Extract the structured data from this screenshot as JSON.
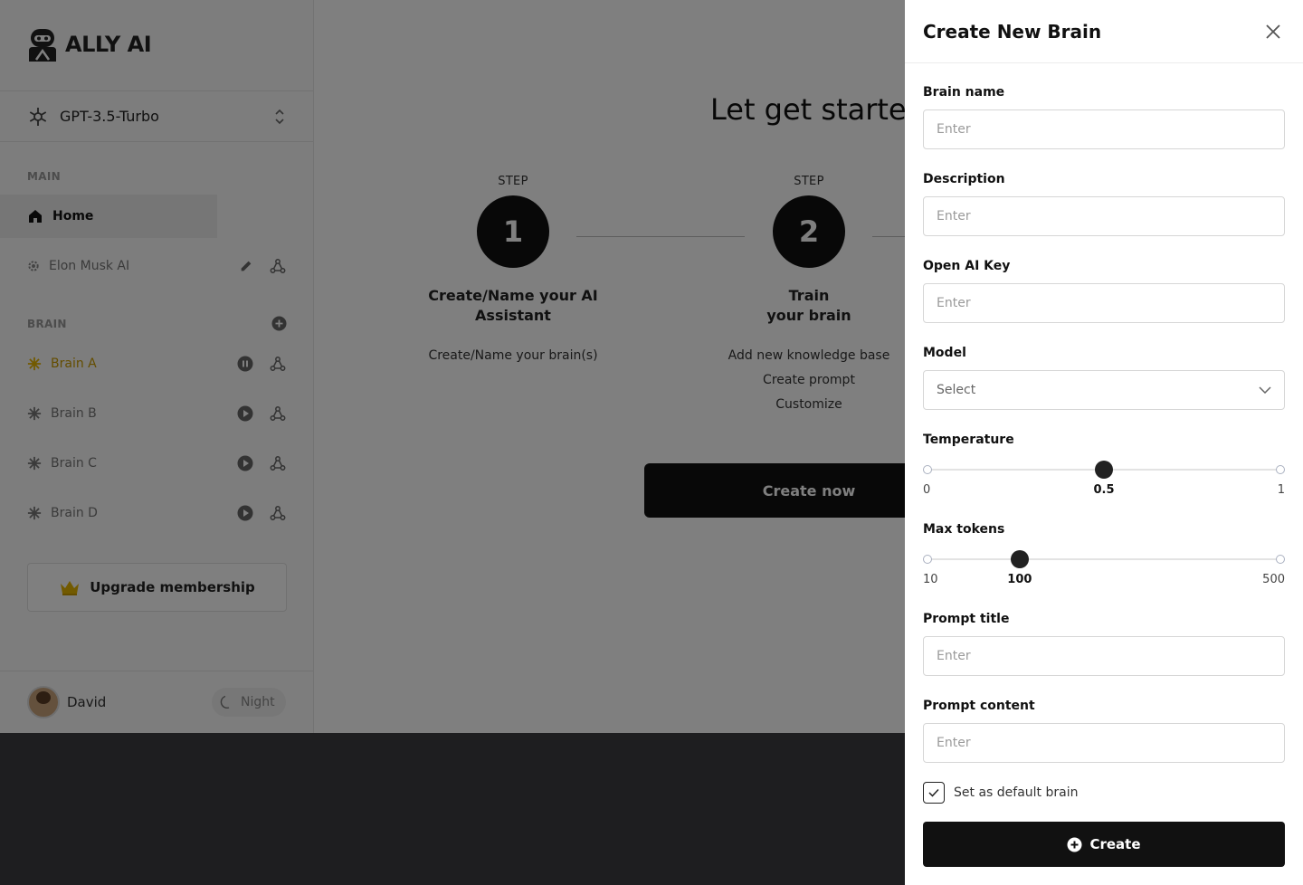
{
  "app": {
    "logo_text": "ALLY AI"
  },
  "sidebar": {
    "model": "GPT-3.5-Turbo",
    "main_section": "MAIN",
    "home_label": "Home",
    "assistant_label": "Elon Musk AI",
    "brain_section": "BRAIN",
    "brains": [
      {
        "label": "Brain A",
        "state": "pause"
      },
      {
        "label": "Brain B",
        "state": "play"
      },
      {
        "label": "Brain C",
        "state": "play"
      },
      {
        "label": "Brain D",
        "state": "play"
      }
    ],
    "upgrade_label": "Upgrade membership",
    "user_name": "David",
    "theme_toggle": "Night"
  },
  "main": {
    "title": "Let get started",
    "step_label": "STEP",
    "steps": [
      {
        "number": "1",
        "title_line1": "Create/Name your AI",
        "title_line2": "Assistant",
        "desc": [
          "Create/Name your brain(s)"
        ]
      },
      {
        "number": "2",
        "title_line1": "Train",
        "title_line2": "your brain",
        "desc": [
          "Add new knowledge base",
          "Create prompt",
          "Customize"
        ]
      }
    ],
    "cta": "Create now"
  },
  "drawer": {
    "title": "Create New Brain",
    "brain_name": {
      "label": "Brain name",
      "placeholder": "Enter"
    },
    "description": {
      "label": "Description",
      "placeholder": "Enter"
    },
    "openai_key": {
      "label": "Open AI Key",
      "placeholder": "Enter"
    },
    "model": {
      "label": "Model",
      "value": "Select"
    },
    "temperature": {
      "label": "Temperature",
      "min": "0",
      "max": "1",
      "value": "0.5",
      "fraction": 0.5
    },
    "max_tokens": {
      "label": "Max tokens",
      "min": "10",
      "max": "500",
      "value": "100",
      "fraction": 0.2612
    },
    "prompt_title": {
      "label": "Prompt title",
      "placeholder": "Enter"
    },
    "prompt_content": {
      "label": "Prompt content",
      "placeholder": "Enter"
    },
    "default_checkbox": {
      "label": "Set as default brain",
      "checked": true
    },
    "create_label": "Create"
  },
  "colors": {
    "accent": "#111111",
    "brain_active": "#e5b400"
  }
}
